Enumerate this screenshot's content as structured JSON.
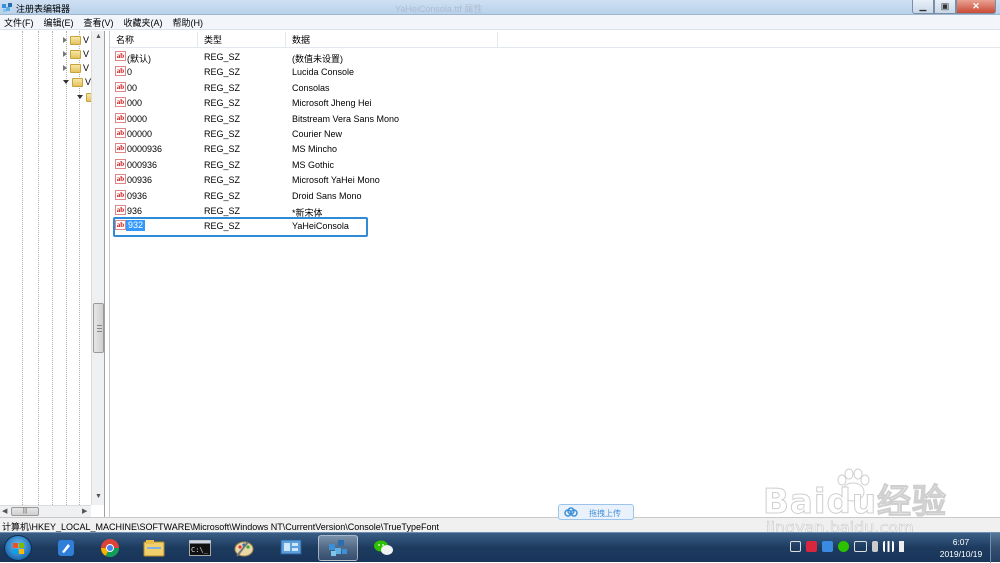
{
  "window": {
    "title": "注册表编辑器",
    "ghost_title": "YaHeiConsola.ttf 属性",
    "buttons": {
      "minimize": "▁",
      "maximize": "▣",
      "close": "✕"
    }
  },
  "menu": [
    "文件(F)",
    "编辑(E)",
    "查看(V)",
    "收藏夹(A)",
    "帮助(H)"
  ],
  "tree": {
    "nodes": [
      {
        "label": "V",
        "expanded": false
      },
      {
        "label": "V",
        "expanded": false
      },
      {
        "label": "V",
        "expanded": false
      },
      {
        "label": "V",
        "expanded": true
      },
      {
        "label": "",
        "expanded": true
      }
    ]
  },
  "list": {
    "columns": [
      "名称",
      "类型",
      "数据"
    ],
    "rows": [
      {
        "name": "(默认)",
        "type": "REG_SZ",
        "data": "(数值未设置)"
      },
      {
        "name": "0",
        "type": "REG_SZ",
        "data": "Lucida Console"
      },
      {
        "name": "00",
        "type": "REG_SZ",
        "data": "Consolas"
      },
      {
        "name": "000",
        "type": "REG_SZ",
        "data": "Microsoft Jheng Hei"
      },
      {
        "name": "0000",
        "type": "REG_SZ",
        "data": "Bitstream Vera Sans Mono"
      },
      {
        "name": "00000",
        "type": "REG_SZ",
        "data": "Courier New"
      },
      {
        "name": "0000936",
        "type": "REG_SZ",
        "data": "MS Mincho"
      },
      {
        "name": "000936",
        "type": "REG_SZ",
        "data": "MS Gothic"
      },
      {
        "name": "00936",
        "type": "REG_SZ",
        "data": "Microsoft YaHei Mono"
      },
      {
        "name": "0936",
        "type": "REG_SZ",
        "data": "Droid Sans Mono"
      },
      {
        "name": "936",
        "type": "REG_SZ",
        "data": "*新宋体"
      },
      {
        "name": "932",
        "type": "REG_SZ",
        "data": "YaHeiConsola",
        "selected": true
      }
    ],
    "value_icon": "ab"
  },
  "status": {
    "path": "计算机\\HKEY_LOCAL_MACHINE\\SOFTWARE\\Microsoft\\Windows NT\\CurrentVersion\\Console\\TrueTypeFont"
  },
  "upload": {
    "label": "拖拽上传"
  },
  "watermark": {
    "brand": "Baidu经验",
    "url": "jingyan.baidu.com"
  },
  "taskbar": {
    "apps": [
      "pen-app-icon",
      "chrome-icon",
      "explorer-icon",
      "cmd-icon",
      "paint-icon",
      "control-panel-icon",
      "regedit-icon",
      "wechat-icon"
    ],
    "active_app": "regedit-icon",
    "tray": [
      "window-icon",
      "sogou-icon",
      "app-icon",
      "wechat-tray-icon",
      "keyboard-icon",
      "usb-icon",
      "signal-icon",
      "volume-icon"
    ]
  },
  "clock": {
    "time": "6:07",
    "date": "2019/10/19"
  },
  "colors": {
    "selection": "#3399ff",
    "focus_box": "#2f8bd8",
    "taskbar": "#1d3b5f"
  }
}
